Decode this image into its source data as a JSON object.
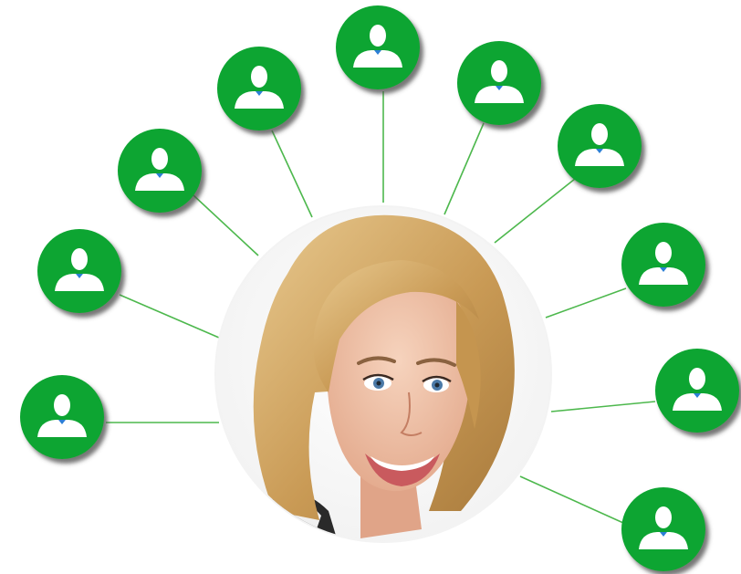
{
  "colors": {
    "node_fill": "#0ca530",
    "node_shadow": "#5e5e5e",
    "connector": "#4db84d",
    "icon_body": "#ffffff",
    "icon_collar": "#2c7fd6"
  },
  "center_node": {
    "icon": "woman-portrait-photo"
  },
  "contact_nodes": [
    {
      "icon": "user-silhouette-icon"
    },
    {
      "icon": "user-silhouette-icon"
    },
    {
      "icon": "user-silhouette-icon"
    },
    {
      "icon": "user-silhouette-icon"
    },
    {
      "icon": "user-silhouette-icon"
    },
    {
      "icon": "user-silhouette-icon"
    },
    {
      "icon": "user-silhouette-icon"
    },
    {
      "icon": "user-silhouette-icon"
    },
    {
      "icon": "user-silhouette-icon"
    },
    {
      "icon": "user-silhouette-icon"
    }
  ]
}
